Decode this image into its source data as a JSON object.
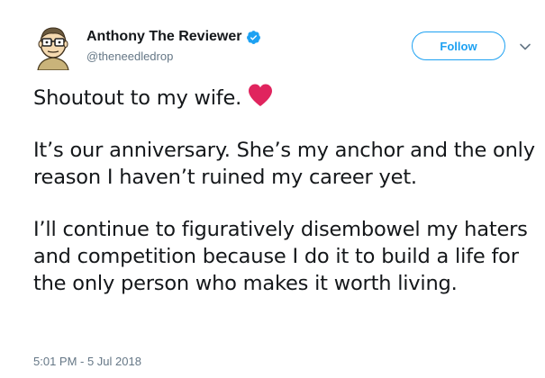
{
  "author": {
    "display_name": "Anthony The Reviewer",
    "handle": "@theneedledrop",
    "verified_icon": "verified-badge-icon",
    "avatar_icon": "cartoon-avatar-glasses"
  },
  "actions": {
    "follow_label": "Follow",
    "menu_icon": "chevron-down-icon"
  },
  "tweet": {
    "line1": "Shoutout to my wife.",
    "emoji_icon": "red-heart-icon",
    "paragraph2": "It’s our anniversary. She’s my anchor and the only reason I haven’t ruined my career yet.",
    "paragraph3": "I’ll continue to figuratively disembowel my haters and competition because I do it to build a life for the only person who makes it worth living."
  },
  "timestamp": "5:01 PM - 5 Jul 2018",
  "colors": {
    "accent": "#1da1f2",
    "text": "#14171a",
    "secondary": "#657786",
    "heart": "#e0245e"
  }
}
